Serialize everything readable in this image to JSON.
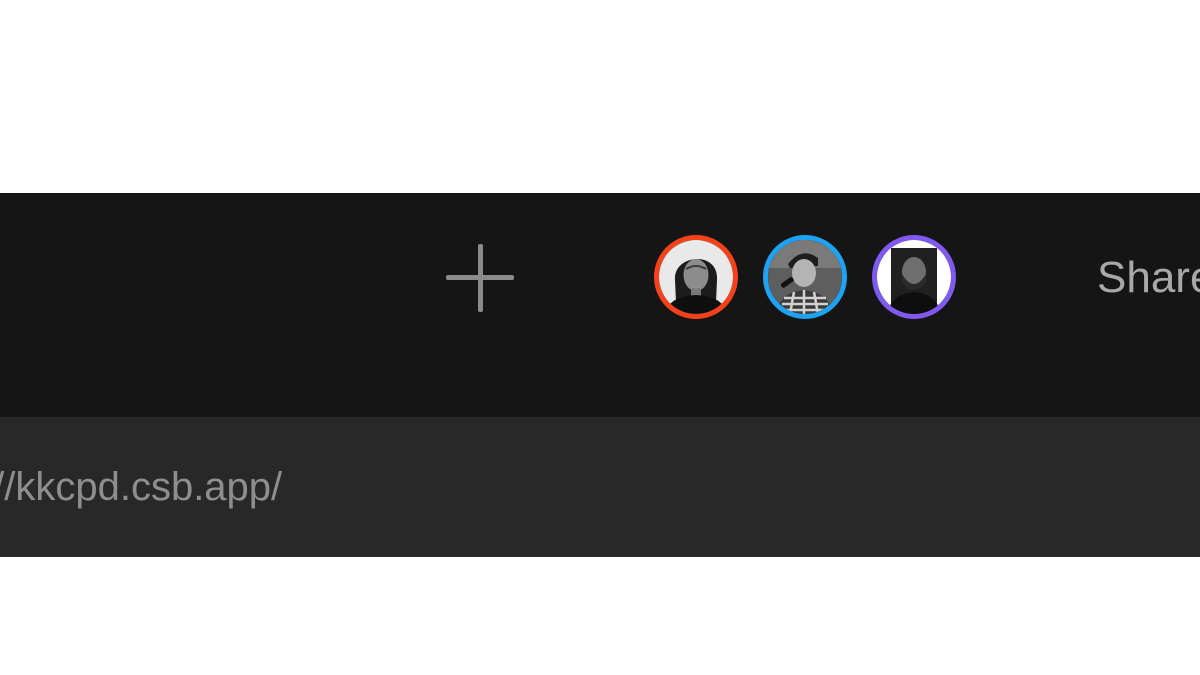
{
  "toolbar": {
    "add_icon": "plus-icon",
    "collaborators": [
      {
        "icon": "avatar-woman",
        "ring_color": "#f7411a"
      },
      {
        "icon": "avatar-man-microphone",
        "ring_color": "#1ea2f2"
      },
      {
        "icon": "avatar-man-beard",
        "ring_color": "#8159f0"
      }
    ],
    "share_label": "Share"
  },
  "address_bar": {
    "url": "://kkcpd.csb.app/"
  },
  "colors": {
    "toolbar_bg": "#151515",
    "address_bar_bg": "#282828",
    "text_muted": "#8e8e8e"
  }
}
